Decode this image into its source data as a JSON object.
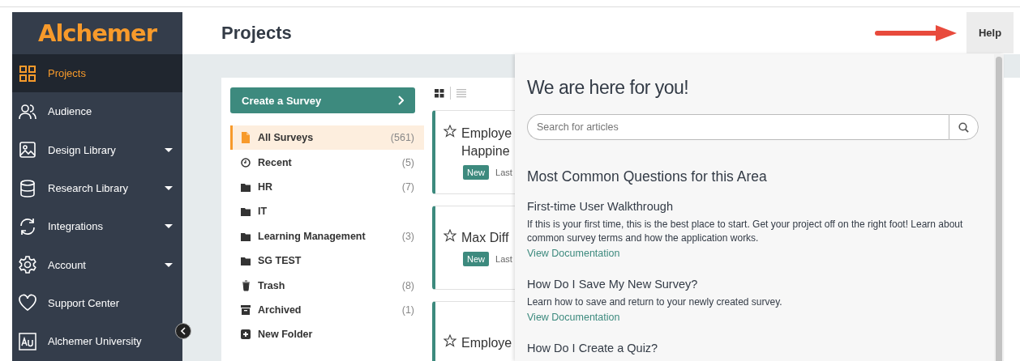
{
  "logo": "Alchemer",
  "sidebar": {
    "items": [
      {
        "label": "Projects",
        "selected": true,
        "expandable": false
      },
      {
        "label": "Audience",
        "selected": false,
        "expandable": false
      },
      {
        "label": "Design Library",
        "selected": false,
        "expandable": true
      },
      {
        "label": "Research Library",
        "selected": false,
        "expandable": true
      },
      {
        "label": "Integrations",
        "selected": false,
        "expandable": true
      },
      {
        "label": "Account",
        "selected": false,
        "expandable": true
      },
      {
        "label": "Support Center",
        "selected": false,
        "expandable": false
      },
      {
        "label": "Alchemer University",
        "selected": false,
        "expandable": false
      }
    ]
  },
  "header": {
    "title": "Projects",
    "help_button": "Help"
  },
  "projects": {
    "create_button": "Create a Survey",
    "folders": [
      {
        "kind": "all",
        "label": "All Surveys",
        "count": "(561)",
        "selected": true
      },
      {
        "kind": "recent",
        "label": "Recent",
        "count": "(5)",
        "selected": false
      },
      {
        "kind": "folder",
        "label": "HR",
        "count": "(7)",
        "selected": false
      },
      {
        "kind": "folder",
        "label": "IT",
        "selected": false
      },
      {
        "kind": "folder",
        "label": "Learning Management",
        "count": "(3)",
        "selected": false
      },
      {
        "kind": "folder",
        "label": "SG TEST",
        "selected": false
      },
      {
        "kind": "trash",
        "label": "Trash",
        "count": "(8)",
        "selected": false
      },
      {
        "kind": "archive",
        "label": "Archived",
        "count": "(1)",
        "selected": false
      },
      {
        "kind": "add",
        "label": "New Folder",
        "selected": false
      }
    ],
    "view_toggle": [
      {
        "kind": "grid",
        "selected": true
      },
      {
        "kind": "list",
        "selected": false
      }
    ],
    "cards": [
      {
        "title_lines": [
          "Employe",
          "Happine"
        ],
        "badge": "New",
        "meta": "Last"
      },
      {
        "title_lines": [
          "Max Diff"
        ],
        "badge": "New",
        "meta": "Last"
      },
      {
        "title_lines": [
          "Employe"
        ]
      }
    ]
  },
  "help": {
    "title": "We are here for you!",
    "search_placeholder": "Search for articles",
    "section_title": "Most Common Questions for this Area",
    "articles": [
      {
        "title": "First-time User Walkthrough",
        "description": "If this is your first time, this is the best place to start. Get your project off on the right foot! Learn about common survey terms and how the application works.",
        "link": "View Documentation"
      },
      {
        "title": "How Do I Save My New Survey?",
        "description": "Learn how to save and return to your newly created survey.",
        "link": "View Documentation"
      },
      {
        "title": "How Do I Create a Quiz?"
      }
    ]
  }
}
